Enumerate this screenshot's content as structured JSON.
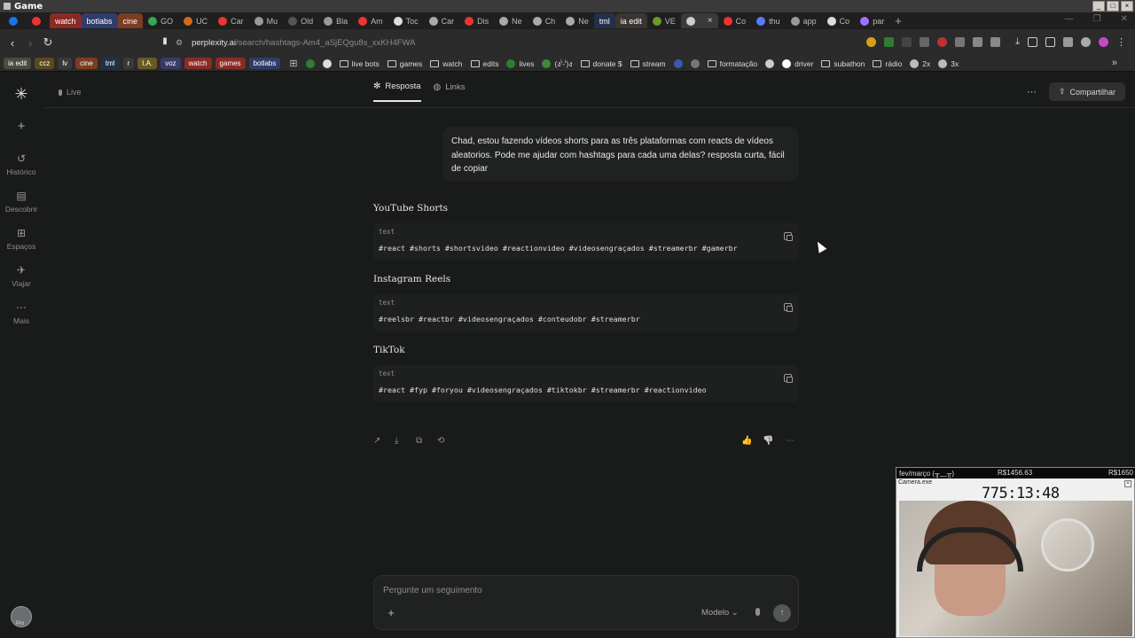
{
  "os": {
    "title": "Game"
  },
  "tabs": [
    {
      "label": "",
      "color": "#1a73e8",
      "colored": false
    },
    {
      "label": "",
      "color": "#e33",
      "colored": false
    },
    {
      "label": "watch",
      "color": "#b7302a",
      "colored": true,
      "bg": "#8b2a24"
    },
    {
      "label": "botlabs",
      "color": "#3a4a7a",
      "colored": true,
      "bg": "#2e3d6a"
    },
    {
      "label": "cine",
      "color": "#a0522d",
      "colored": true,
      "bg": "#7a3d20"
    },
    {
      "label": "GO",
      "color": "#34a853",
      "colored": false
    },
    {
      "label": "UC",
      "color": "#d2691e",
      "colored": false
    },
    {
      "label": "Car",
      "color": "#e33",
      "colored": false
    },
    {
      "label": "Mu",
      "color": "#999",
      "colored": false
    },
    {
      "label": "Old",
      "color": "#555",
      "colored": false
    },
    {
      "label": "Bla",
      "color": "#999",
      "colored": false
    },
    {
      "label": "Am",
      "color": "#e33",
      "colored": false
    },
    {
      "label": "Toc",
      "color": "#ddd",
      "colored": false
    },
    {
      "label": "Car",
      "color": "#aaa",
      "colored": false
    },
    {
      "label": "Dis",
      "color": "#e33",
      "colored": false
    },
    {
      "label": "Ne",
      "color": "#aaa",
      "colored": false
    },
    {
      "label": "Ch",
      "color": "#aaa",
      "colored": false
    },
    {
      "label": "Ne",
      "color": "#aaa",
      "colored": false
    },
    {
      "label": "tml",
      "color": "#2a3a5a",
      "colored": true,
      "bg": "#22304a"
    },
    {
      "label": "ia edit",
      "color": "#3a3a2a",
      "colored": true,
      "bg": "#3a3530"
    },
    {
      "label": "VE",
      "color": "#6a9a2a",
      "colored": false
    },
    {
      "label": "",
      "color": "#ccc",
      "colored": false,
      "active": true
    },
    {
      "label": "Co",
      "color": "#e33",
      "colored": false
    },
    {
      "label": "thu",
      "color": "#5a7aff",
      "colored": false
    },
    {
      "label": "app",
      "color": "#999",
      "colored": false
    },
    {
      "label": "Co",
      "color": "#ddd",
      "colored": false
    },
    {
      "label": "par",
      "color": "#a070ff",
      "colored": false
    }
  ],
  "address": {
    "domain": "perplexity.ai",
    "path": "/search/hashtags-Am4_aSjEQgu8s_xxKH4FWA"
  },
  "bookmarks_pills": [
    {
      "label": "ia edit",
      "bg": "#4a4a40"
    },
    {
      "label": "ccz",
      "bg": "#5a4a20"
    },
    {
      "label": "lv",
      "bg": "#3a3a3a"
    },
    {
      "label": "cine",
      "bg": "#7a3d20"
    },
    {
      "label": "tml",
      "bg": "#22304a"
    },
    {
      "label": "r",
      "bg": "#3a3a3a"
    },
    {
      "label": "I.A.",
      "bg": "#6a5a20"
    },
    {
      "label": "voz",
      "bg": "#3a3a6a"
    },
    {
      "label": "watch",
      "bg": "#8b2a24"
    },
    {
      "label": "games",
      "bg": "#8b2a24"
    },
    {
      "label": "botlabs",
      "bg": "#2e3d6a"
    }
  ],
  "bookmarks": [
    {
      "label": "",
      "type": "dot",
      "color": "#2e7d32"
    },
    {
      "label": "",
      "type": "dot",
      "color": "#ddd"
    },
    {
      "label": "live bots",
      "type": "folder"
    },
    {
      "label": "games",
      "type": "folder"
    },
    {
      "label": "watch",
      "type": "folder"
    },
    {
      "label": "edits",
      "type": "folder"
    },
    {
      "label": "lives",
      "type": "dot",
      "color": "#2e7d32"
    },
    {
      "label": "(ง'̀-'́)ง",
      "type": "dot",
      "color": "#3a8a3a"
    },
    {
      "label": "donate $",
      "type": "folder"
    },
    {
      "label": "stream",
      "type": "folder"
    },
    {
      "label": "",
      "type": "dot",
      "color": "#3a5aaa"
    },
    {
      "label": "",
      "type": "dot",
      "color": "#777"
    },
    {
      "label": "formatação",
      "type": "folder"
    },
    {
      "label": "",
      "type": "dot",
      "color": "#ccc"
    },
    {
      "label": "driver",
      "type": "dot",
      "color": "#fff"
    },
    {
      "label": "subathon",
      "type": "folder"
    },
    {
      "label": "rádio",
      "type": "folder"
    },
    {
      "label": "2x",
      "type": "dot",
      "color": "#bbb"
    },
    {
      "label": "3x",
      "type": "dot",
      "color": "#bbb"
    }
  ],
  "sidebar": {
    "live_label": "Live",
    "items": [
      {
        "label": "Histórico",
        "icon": "history-icon",
        "glyph": "↺"
      },
      {
        "label": "Descobrir",
        "icon": "discover-icon",
        "glyph": "▤"
      },
      {
        "label": "Espaços",
        "icon": "spaces-icon",
        "glyph": "⊞"
      },
      {
        "label": "Viajar",
        "icon": "travel-icon",
        "glyph": "✈"
      },
      {
        "label": "Mais",
        "icon": "more-icon",
        "glyph": "⋯"
      }
    ],
    "avatar_badge": "Pro"
  },
  "header": {
    "tabs": [
      {
        "label": "Resposta",
        "active": true
      },
      {
        "label": "Links",
        "active": false
      }
    ],
    "share_label": "Compartilhar"
  },
  "thread": {
    "user_message": "Chad, estou fazendo vídeos shorts para as três plataformas com reacts de vídeos aleatorios. Pode me ajudar com hashtags para cada uma delas? resposta curta, fácil de copiar",
    "sections": [
      {
        "title": "YouTube Shorts",
        "lang": "text",
        "code": "#react #shorts #shortsvideo #reactionvideo #videosengraçados #streamerbr #gamerbr"
      },
      {
        "title": "Instagram Reels",
        "lang": "text",
        "code": "#reelsbr #reactbr #videosengraçados #conteudobr #streamerbr"
      },
      {
        "title": "TikTok",
        "lang": "text",
        "code": "#react #fyp #foryou #videosengraçados #tiktokbr #streamerbr #reactionvideo"
      }
    ]
  },
  "composer": {
    "placeholder": "Pergunte um seguimento",
    "model_label": "Modelo"
  },
  "overlay": {
    "title": "fev/março (╥﹏╥)",
    "value1": "R$1456.63",
    "value2": "R$1650",
    "window_title": "Camera.exe",
    "timer": "775:13:48"
  }
}
